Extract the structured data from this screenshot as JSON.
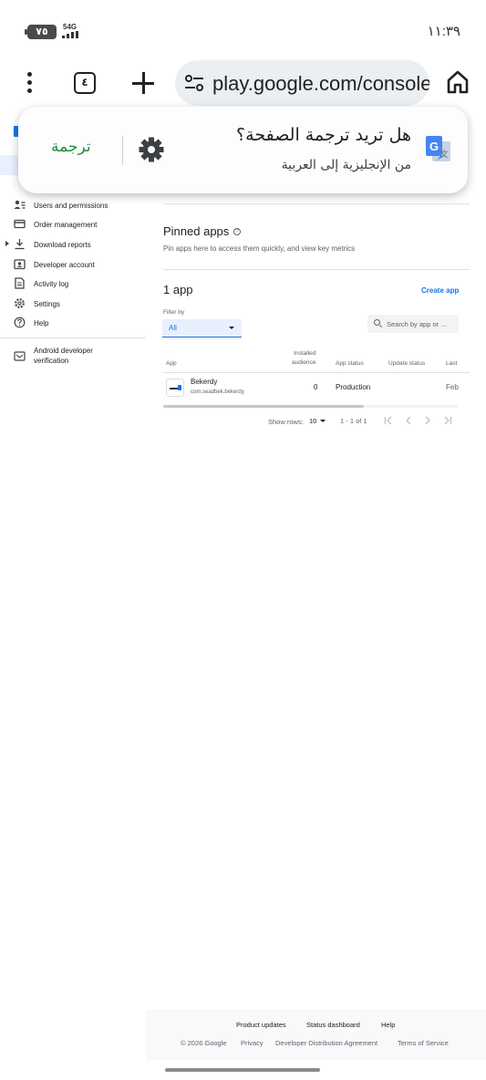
{
  "status_bar": {
    "battery": "٧٥",
    "network": "4G",
    "network_badge": "5",
    "time": "١١:٣٩"
  },
  "browser": {
    "tab_count": "٤",
    "url": "play.google.com/console"
  },
  "translate_popup": {
    "title": "هل تريد ترجمة الصفحة؟",
    "subtitle": "من الإنجليزية إلى العربية",
    "translate_label": "ترجمة",
    "icons": [
      "google-translate-icon",
      "gear-icon"
    ]
  },
  "sidebar": {
    "items": [
      {
        "label": "Users and permissions",
        "icon": "users-icon"
      },
      {
        "label": "Order management",
        "icon": "card-icon"
      },
      {
        "label": "Download reports",
        "icon": "download-icon"
      },
      {
        "label": "Developer account",
        "icon": "account-icon"
      },
      {
        "label": "Activity log",
        "icon": "log-icon"
      },
      {
        "label": "Settings",
        "icon": "gear-icon"
      },
      {
        "label": "Help",
        "icon": "help-icon"
      }
    ],
    "verification": {
      "line1": "Android developer",
      "line2": "verification"
    }
  },
  "main": {
    "pinned_title": "Pinned apps",
    "pinned_desc": "Pin apps here to access them quickly, and view key metrics",
    "apps_count": "1 app",
    "create_app": "Create app",
    "filter_label": "Filter by",
    "filter_value": "All",
    "search_placeholder": "Search by app or ...",
    "table": {
      "headers": {
        "app": "App",
        "installed_line1": "Installed",
        "installed_line2": "audience",
        "app_status": "App status",
        "update_status": "Update status",
        "last": "Last"
      },
      "rows": [
        {
          "name": "Bekerdy",
          "package": "com.seadbek.bekerdy",
          "installed": "0",
          "status": "Production",
          "update_status": "",
          "last": "Feb"
        }
      ]
    },
    "show_rows_label": "Show rows:",
    "rows_per_page": "10",
    "range": "1 - 1 of 1"
  },
  "footer": {
    "links_row1": [
      "Product updates",
      "Status dashboard",
      "Help"
    ],
    "copyright": "© 2026 Google",
    "links_row2": [
      "Privacy",
      "Developer Distribution Agreement",
      "Terms of Service"
    ]
  }
}
